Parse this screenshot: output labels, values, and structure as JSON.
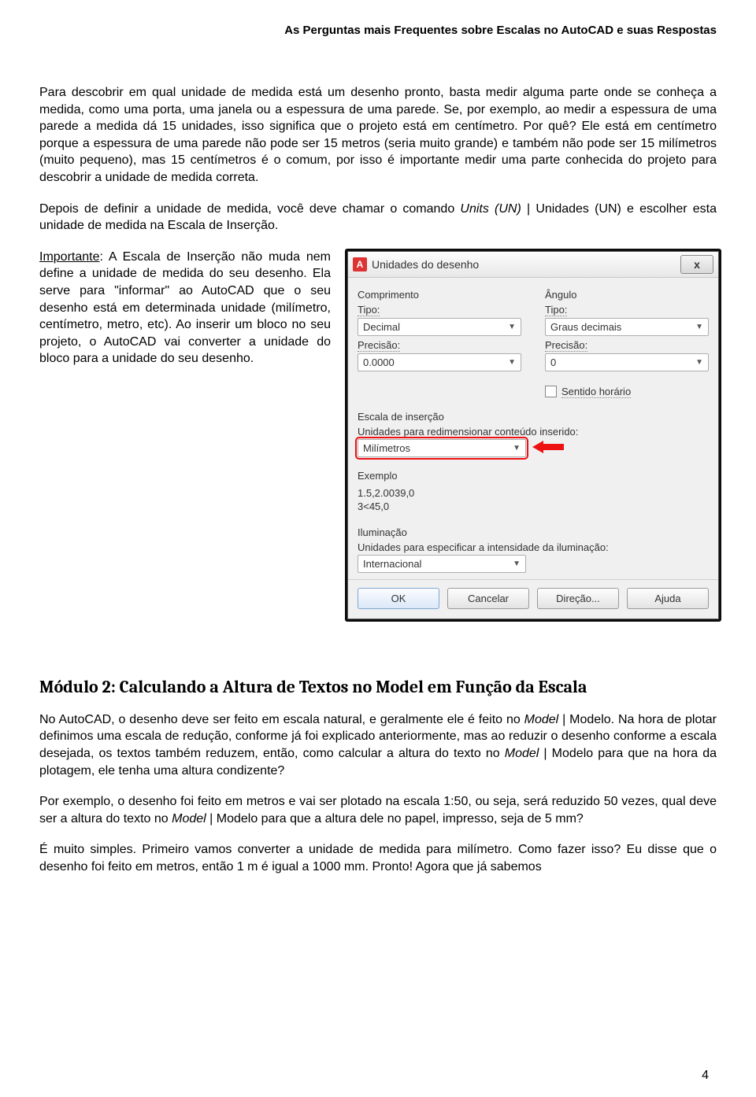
{
  "header": "As Perguntas mais Frequentes sobre Escalas no AutoCAD e suas Respostas",
  "p1_a": "Para descobrir em qual unidade de medida está um desenho pronto, basta medir alguma parte onde se conheça a medida, como uma porta, uma janela ou a espessura de uma parede. Se, por exemplo, ao medir a espessura de uma parede a medida dá 15 unidades, isso significa que o projeto está em centímetro. Por quê? Ele está em centímetro porque a espessura de uma parede não pode ser 15 metros (seria muito grande) e também não pode ser 15 milímetros (muito pequeno), mas 15 centímetros é o comum, por isso é importante medir uma parte conhecida do projeto para descobrir a unidade de medida correta.",
  "p2_a": "Depois de definir a unidade de medida, você deve chamar o comando ",
  "p2_b": "Units (UN)",
  "p2_c": " | Unidades (UN) e escolher esta unidade de medida na Escala de Inserção.",
  "p3_a": "Importante",
  "p3_b": ": A Escala de Inserção não muda nem define a unidade de medida do seu desenho. Ela serve para \"informar\" ao AutoCAD que o seu desenho está em determinada unidade (milímetro, centímetro, metro, etc). Ao inserir um bloco no seu projeto, o AutoCAD vai converter a unidade do bloco para a unidade do seu desenho.",
  "dialog": {
    "icon_letter": "A",
    "title": "Unidades do desenho",
    "close_x": "x",
    "length_label": "Comprimento",
    "angle_label": "Ângulo",
    "type_label": "Tipo:",
    "length_type": "Decimal",
    "angle_type": "Graus decimais",
    "precision_label": "Precisão:",
    "length_precision": "0.0000",
    "angle_precision": "0",
    "clockwise": "Sentido horário",
    "insertion_label": "Escala de inserção",
    "insertion_sub": "Unidades para redimensionar conteúdo inserido:",
    "insertion_value": "Milímetros",
    "example_label": "Exemplo",
    "example_l1": "1.5,2.0039,0",
    "example_l2": "3<45,0",
    "lighting_label": "Iluminação",
    "lighting_sub": "Unidades para especificar a intensidade da iluminação:",
    "lighting_value": "Internacional",
    "btn_ok": "OK",
    "btn_cancel": "Cancelar",
    "btn_direction": "Direção...",
    "btn_help": "Ajuda"
  },
  "h2": "Módulo 2: Calculando a Altura de Textos no Model em Função da Escala",
  "p4_a": "No AutoCAD, o desenho deve ser feito em escala natural, e geralmente ele é feito no ",
  "p4_b": "Model",
  "p4_c": " | Modelo. Na hora de plotar definimos uma escala de redução, conforme já foi explicado anteriormente, mas ao reduzir o desenho conforme a escala desejada, os textos também reduzem, então, como calcular a altura do texto no ",
  "p4_d": "Model",
  "p4_e": " | Modelo para que na hora da plotagem, ele tenha uma altura condizente?",
  "p5_a": "Por exemplo, o desenho foi feito em metros e vai ser plotado na escala 1:50, ou seja, será reduzido 50 vezes, qual deve ser a altura do texto no ",
  "p5_b": "Model",
  "p5_c": " | Modelo para que a altura dele no papel, impresso, seja de 5 mm?",
  "p6": "É muito simples. Primeiro vamos converter a unidade de medida para milímetro. Como fazer isso? Eu disse que o desenho foi feito em metros, então 1 m é igual a 1000 mm. Pronto! Agora que já sabemos",
  "page_number": "4"
}
